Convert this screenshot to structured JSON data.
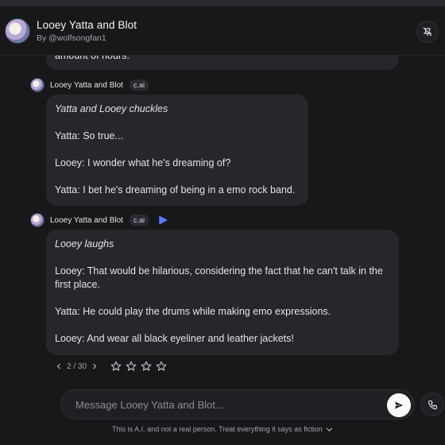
{
  "header": {
    "character_name": "Looey Yatta and Blot",
    "author": "By @wolfsongfan1",
    "menu_icon": "pin-off-icon"
  },
  "messages": [
    {
      "partial_text": "amount of hours."
    },
    {
      "sender": "Looey Yatta and Blot",
      "badge": "c.ai",
      "lines": [
        "Yatta and Looey chuckles",
        "Yatta: So true...",
        "Looey: I wonder what he's dreaming of?",
        "Yatta: I bet he's dreaming of being in a emo rock band."
      ]
    },
    {
      "sender": "Looey Yatta and Blot",
      "badge": "c.ai",
      "play_icon": "play-icon",
      "lines": [
        "Looey laughs",
        "Looey: That would be hilarious, considering the fact that he can't talk in the first place.",
        "Yatta: He could play the drums while making emo expressions.",
        "Looey: And wear all black eyeliner and leather jackets!"
      ]
    }
  ],
  "swipe": {
    "counter": "2 / 30"
  },
  "rating": {
    "stars": 4
  },
  "input": {
    "placeholder": "Message Looey Yatta and Blot...",
    "value": ""
  },
  "footer": {
    "disclaimer": "This is A.I. and not a real person. Treat everything it says as fiction"
  },
  "colors": {
    "background": "#18181b",
    "bubble": "#26262b",
    "accent": "#5b7cfa"
  }
}
